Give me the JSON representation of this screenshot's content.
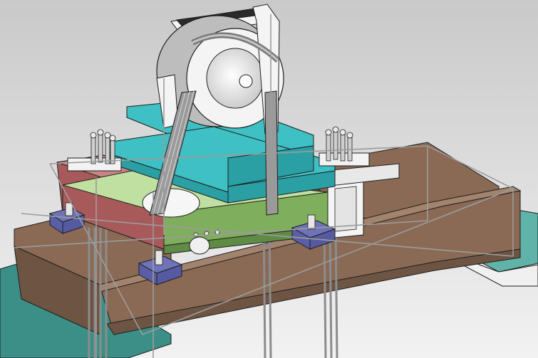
{
  "scene": {
    "subject": "cad-model",
    "colors": {
      "background_top": "#c9c9c9",
      "background_bottom": "#f2f2f2",
      "beam_brown": "#8a6a55",
      "beam_brown_dark": "#6e5443",
      "beam_brown_light": "#a3836d",
      "plate_teal": "#3b8f86",
      "plate_teal_light": "#5fb3a8",
      "frame_green": "#7fae5c",
      "frame_green_dark": "#5f8c44",
      "bed_cyan": "#3fc0c4",
      "bed_cyan_dark": "#2aa0a4",
      "side_red": "#a85a5a",
      "mount_blue": "#6f73b8",
      "sheave_white": "#f4f4f4",
      "sheave_gray": "#bdbdbd",
      "rope_gray": "#9a9a9a",
      "outline": "#1e1e1e",
      "edge_highlight": "#9c9c9c"
    }
  }
}
